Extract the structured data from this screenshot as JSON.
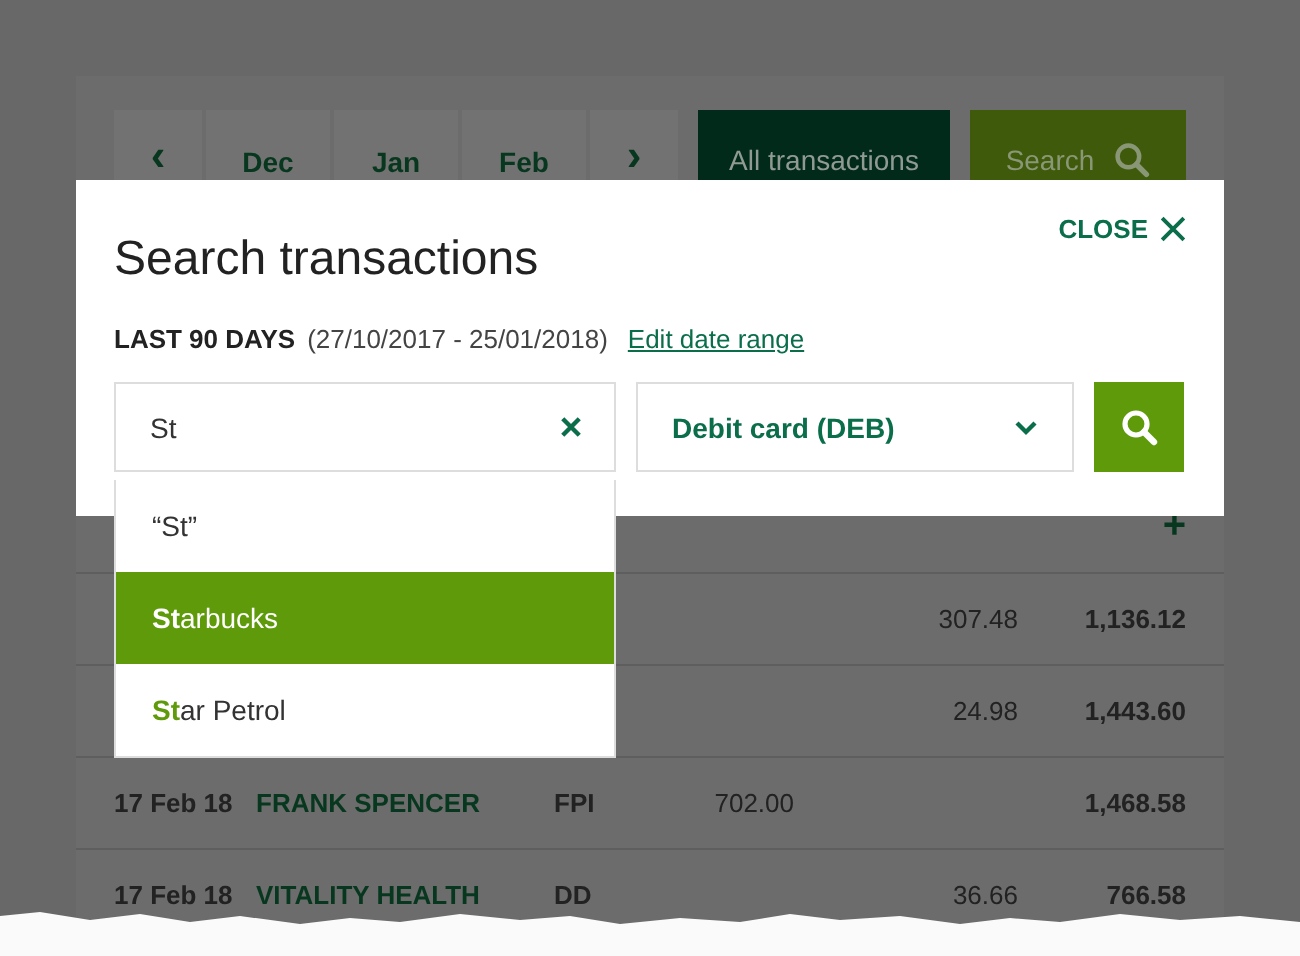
{
  "month_nav": {
    "prev": "‹",
    "months": [
      {
        "label": "Dec",
        "selected": false
      },
      {
        "label": "Jan",
        "selected": false
      },
      {
        "label": "Feb",
        "selected": false
      }
    ],
    "next": "›"
  },
  "view_buttons": [
    {
      "label": "All transactions",
      "selected": true
    },
    {
      "label": "Search",
      "selected": false
    }
  ],
  "table": {
    "add_icon": "+",
    "rows": [
      {
        "date": "",
        "description": "",
        "type": "",
        "paid_in": "",
        "paid_out": "307.48",
        "balance": "1,136.12"
      },
      {
        "date": "",
        "description": "",
        "type": "",
        "paid_in": "",
        "paid_out": "24.98",
        "balance": "1,443.60"
      },
      {
        "date": "17 Feb 18",
        "description": "FRANK SPENCER",
        "type": "FPI",
        "paid_in": "702.00",
        "paid_out": "",
        "balance": "1,468.58"
      },
      {
        "date": "17 Feb 18",
        "description": "VITALITY HEALTH",
        "type": "DD",
        "paid_in": "",
        "paid_out": "36.66",
        "balance": "766.58"
      }
    ]
  },
  "modal": {
    "title": "Search transactions",
    "close": "CLOSE",
    "period_label": "LAST 90 DAYS",
    "period_range": "(27/10/2017 - 25/01/2018)",
    "edit_link": "Edit date range",
    "search_field": {
      "value": "St"
    },
    "type_select": {
      "value": "Debit card (DEB)"
    },
    "suggestions": [
      {
        "text": "“St”",
        "selected": false
      },
      {
        "text": "**St**arbucks",
        "selected": true
      },
      {
        "text": "**St**ar Petrol",
        "selected": false
      }
    ]
  }
}
